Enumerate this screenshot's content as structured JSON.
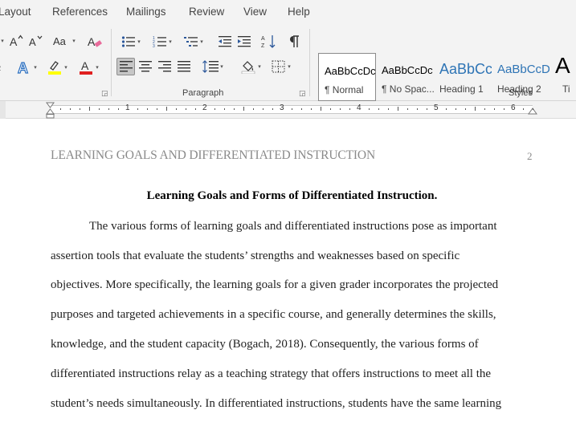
{
  "ribbon_tabs": [
    "Layout",
    "References",
    "Mailings",
    "Review",
    "View",
    "Help"
  ],
  "groups": {
    "paragraph": "Paragraph",
    "styles": "Styles"
  },
  "colors": {
    "highlight": "#ffff00",
    "font_color": "#e02020",
    "accent": "#2b579a"
  },
  "font_group_icons": [
    "grow-font-icon",
    "shrink-font-icon",
    "change-case-icon",
    "clear-formatting-icon",
    "text-effects-icon",
    "highlight-icon",
    "font-color-icon"
  ],
  "paragraph_icons": [
    "bullets-icon",
    "numbering-icon",
    "multilevel-list-icon",
    "decrease-indent-icon",
    "increase-indent-icon",
    "sort-icon",
    "show-marks-icon",
    "align-left-icon",
    "center-icon",
    "align-right-icon",
    "justify-icon",
    "line-spacing-icon",
    "shading-icon",
    "borders-icon"
  ],
  "styles": [
    {
      "sample": "AaBbCcDc",
      "name": "¶ Normal"
    },
    {
      "sample": "AaBbCcDc",
      "name": "¶ No Spac..."
    },
    {
      "sample": "AaBbCc",
      "name": "Heading 1"
    },
    {
      "sample": "AaBbCcD",
      "name": "Heading 2"
    },
    {
      "sample": "A",
      "name": "Ti"
    }
  ],
  "ruler_numbers": [
    "1",
    "2",
    "3",
    "4",
    "5",
    "6"
  ],
  "document": {
    "running_head": "LEARNING GOALS AND DIFFERENTIATED INSTRUCTION",
    "page_number": "2",
    "title": "Learning Goals and Forms of Differentiated Instruction.",
    "lines": [
      "The various forms of learning goals and differentiated instructions pose as important",
      "assertion tools that evaluate the students’ strengths and weaknesses based on specific",
      "objectives. More specifically, the learning goals for a given grader incorporates the projected",
      "purposes and targeted achievements in a specific course, and generally determines the skills,",
      "knowledge, and the student capacity (Bogach, 2018). Consequently, the various forms of",
      "differentiated instructions relay as a teaching strategy that offers instructions to meet all the",
      "student’s needs simultaneously. In differentiated instructions, students have the same learning"
    ]
  }
}
